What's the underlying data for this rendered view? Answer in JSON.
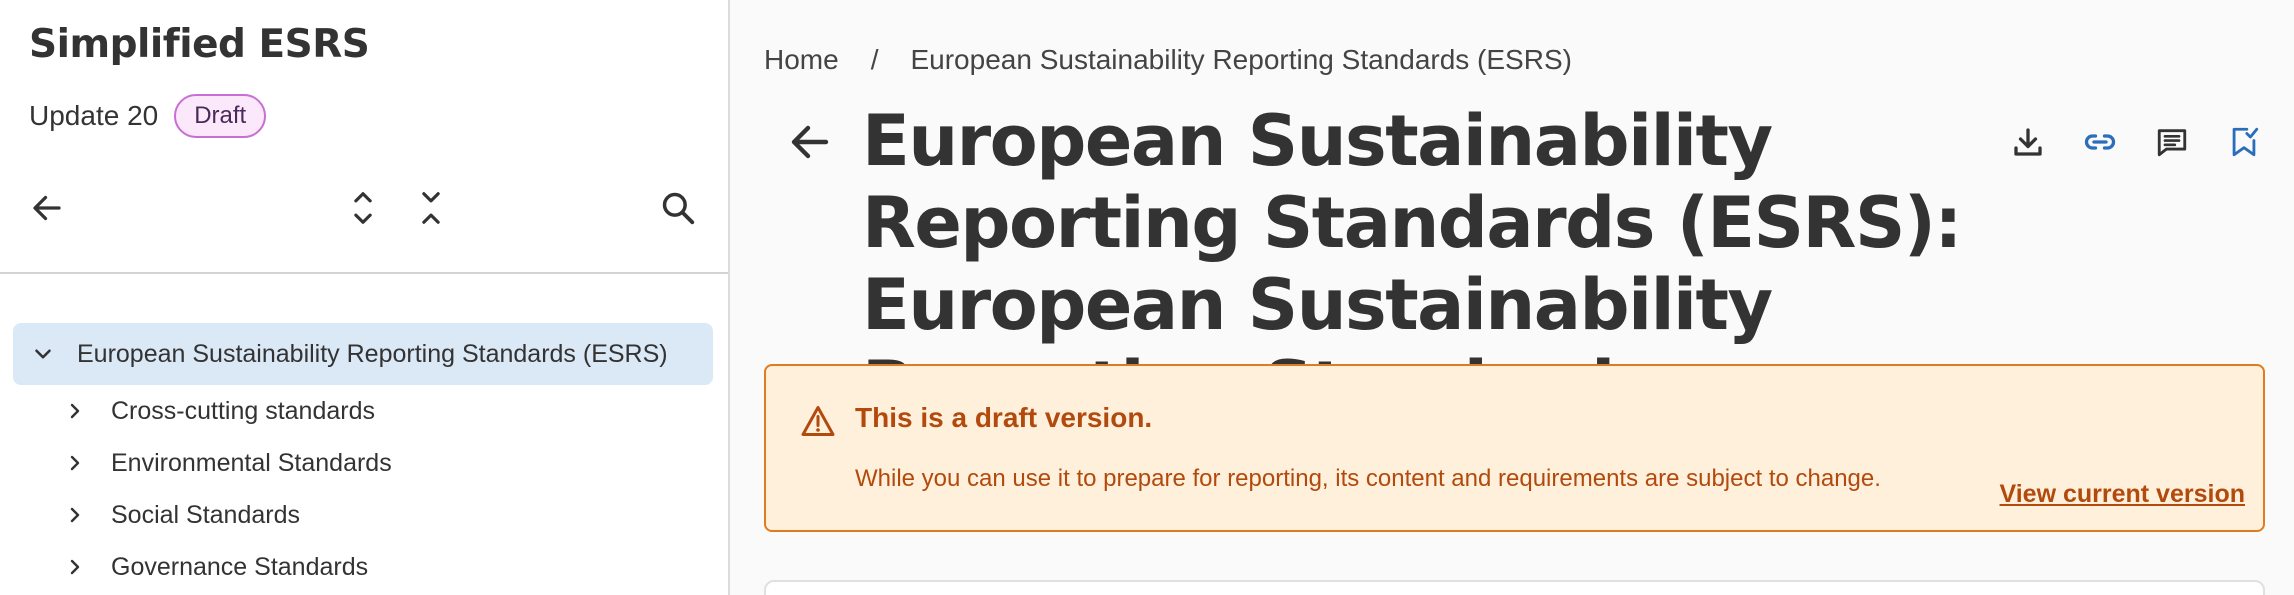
{
  "sidebar": {
    "title": "Simplified ESRS",
    "update": "Update 20",
    "status_badge": "Draft",
    "toolbar": {
      "back_icon": "arrow-left-icon",
      "expand_icon": "expand-all-icon",
      "collapse_icon": "collapse-all-icon",
      "search_icon": "search-icon"
    },
    "tree": {
      "root": {
        "label": "European Sustainability Reporting Standards (ESRS)",
        "expanded": true
      },
      "children": [
        {
          "label": "Cross-cutting standards"
        },
        {
          "label": "Environmental Standards"
        },
        {
          "label": "Social Standards"
        },
        {
          "label": "Governance Standards"
        }
      ]
    }
  },
  "main": {
    "breadcrumb": {
      "home": "Home",
      "separator": "/",
      "current": "European Sustainability Reporting Standards (ESRS)"
    },
    "title": "European Sustainability Reporting Standards (ESRS): European Sustainability Reporting Standards",
    "actions": [
      {
        "icon": "download-icon"
      },
      {
        "icon": "link-icon"
      },
      {
        "icon": "comments-icon"
      },
      {
        "icon": "bookmark-check-icon"
      }
    ],
    "draft_notice": {
      "heading": "This is a draft version.",
      "body": "While you can use it to prepare for reporting, its content and requirements are subject to change.",
      "link": "View current version",
      "icon": "warning-icon"
    }
  },
  "colors": {
    "accent_blue": "#2a6ebb",
    "draft_orange": "#b24a0d",
    "draft_bg": "#fff0dc",
    "badge_border": "#c86fd3",
    "tree_selected_bg": "#dbe8f6"
  }
}
